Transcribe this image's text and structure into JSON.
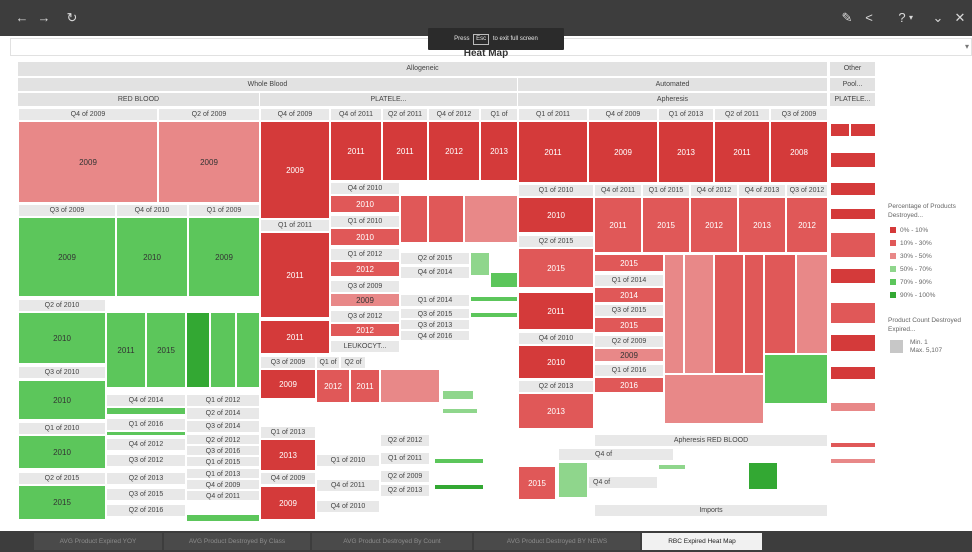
{
  "toolbar": {
    "back": "←",
    "forward": "→",
    "refresh": "↻",
    "edit": "✎",
    "share": "<",
    "help": "?",
    "help_caret": "▾",
    "more": "✕",
    "close": "✕",
    "expand": "⌄"
  },
  "fullscreen_tip": {
    "before": "Press",
    "key": "Esc",
    "after": "to exit full screen"
  },
  "filter": {
    "caret": "▾"
  },
  "viz_title": "Heat Map",
  "treemap": {
    "level1": {
      "allogeneic": "Allogeneic",
      "other": "Other"
    },
    "level2": {
      "whole_blood": "Whole Blood",
      "automated": "Automated",
      "pool": "Pool..."
    },
    "level3": {
      "red_blood": "RED BLOOD",
      "platelet_a": "PLATELE...",
      "apheresis": "Apheresis",
      "platelet_b": "PLATELE..."
    },
    "q": {
      "a": "Q4 of 2009",
      "b": "Q2 of 2009",
      "c": "Q4 of 2009",
      "d": "Q4 of 2011",
      "e": "Q2 of 2011",
      "f": "Q4 of 2012",
      "g": "Q1 of",
      "h": "Q1 of 2011",
      "i": "Q4 of 2009",
      "j": "Q1 of 2013",
      "k": "Q2 of 2011",
      "l": "Q3 of 2009",
      "m": "Q3 of 2009",
      "n": "Q4 of 2010",
      "o": "Q1 of 2009",
      "p": "Q4 of 2010",
      "q": "Q1 of 2011",
      "r": "Q1 of 2010",
      "s": "Q1 of 2010",
      "t": "Q4 of 2011",
      "u": "Q1 of 2015",
      "v": "Q4 of 2012",
      "w": "Q4 of 2013",
      "x": "Q3 of 2012",
      "y": "Q2 of 2015",
      "z": "Q2 of 2010",
      "aa": "Q3 of 2010",
      "ab": "Q1 of 2012",
      "ac": "Q2 of 2015",
      "ad": "Q4 of 2014",
      "ae": "Q3 of 2009",
      "af": "Q1 of 2014",
      "ag": "Q3 of 2015",
      "ah": "Q3 of 2012",
      "ai": "Q3 of 2013",
      "aj": "Q4 of 2016",
      "ak": "Q1 of 2014",
      "al": "Q4 of 2010",
      "am": "Q3 of 2015",
      "an": "Q2 of 2009",
      "ao": "Q3 of 2009",
      "ap": "Q1 of",
      "aq": "Q2 of",
      "ar": "Q4 of 2014",
      "as": "Q1 of 2012",
      "at": "Q2 of 2014",
      "au": "Q1 of 2016",
      "av": "Q3 of 2014",
      "aw": "Q1 of 2013",
      "ax": "Q4 of 2012",
      "ay": "Q2 of 2012",
      "az": "Q2 of 2012",
      "ba": "Q3 of 2016",
      "bb": "Q3 of 2012",
      "bc": "Q1 of 2015",
      "bd": "Q1 of 2010",
      "be": "Q1 of 2011",
      "bf": "Q1 of 2013",
      "bg": "Q2 of 2015",
      "bh": "Q2 of 2013",
      "bi": "Q4 of 2009",
      "bj": "Q2 of 2009",
      "bk": "Q4 of 2011",
      "bl": "Q3 of 2015",
      "bm": "Q2 of 2013",
      "bn": "Q2 of 2016",
      "bo": "Q4 of 2010",
      "bp": "Q2 of 2013",
      "bq": "Q1 of 2016",
      "br": "Q4 of",
      "bs": "Q4 of"
    },
    "y": {
      "a": "2009",
      "b": "2009",
      "c": "2009",
      "d": "2011",
      "e": "2011",
      "f": "2012",
      "g": "2013",
      "h": "2011",
      "i": "2009",
      "j": "2013",
      "k": "2011",
      "l": "2008",
      "m": "2009",
      "n": "2010",
      "o": "2009",
      "p": "2010",
      "q": "2011",
      "r": "2015",
      "s": "2013",
      "t": "2012",
      "u": "2013",
      "v": "2012",
      "w": "2010",
      "x": "2011",
      "y": "2010",
      "z": "2015",
      "aa": "2012",
      "ab": "2015",
      "ac": "2010",
      "ad": "2011",
      "ae": "2014",
      "af": "2011",
      "ag": "2012",
      "ah": "2015",
      "ai": "2010",
      "aj": "2010",
      "ak": "2009",
      "al": "2009",
      "am": "2012",
      "an": "2011",
      "ao": "2013",
      "ap": "2013",
      "aq": "2015",
      "ar": "2009",
      "as": "2015",
      "at": "2016"
    },
    "leukocyte": "LEUKOCYT...",
    "apheresis_red_blood": "Apheresis RED BLOOD",
    "imports": "Imports"
  },
  "legend": {
    "title": "Percentage of Products Destroyed...",
    "items": [
      {
        "label": "0% - 10%",
        "color": "#d43a3a"
      },
      {
        "label": "10% - 30%",
        "color": "#e05858"
      },
      {
        "label": "30% - 50%",
        "color": "#e88888"
      },
      {
        "label": "50% - 70%",
        "color": "#8fd68c"
      },
      {
        "label": "70% - 90%",
        "color": "#5cc65b"
      },
      {
        "label": "90% - 100%",
        "color": "#33a833"
      }
    ],
    "size_title": "Product Count Destroyed Expired...",
    "size_min": "Min. 1",
    "size_max": "Max. 5,107"
  },
  "tabs": [
    {
      "label": "AVG Product Expired YOY",
      "active": false
    },
    {
      "label": "AVG Product Destroyed By Class",
      "active": false
    },
    {
      "label": "AVG Product Destroyed By Count",
      "active": false
    },
    {
      "label": "AVG Product Destroyed BY NEWS",
      "active": false
    },
    {
      "label": "RBC Expired Heat Map",
      "active": true
    }
  ]
}
